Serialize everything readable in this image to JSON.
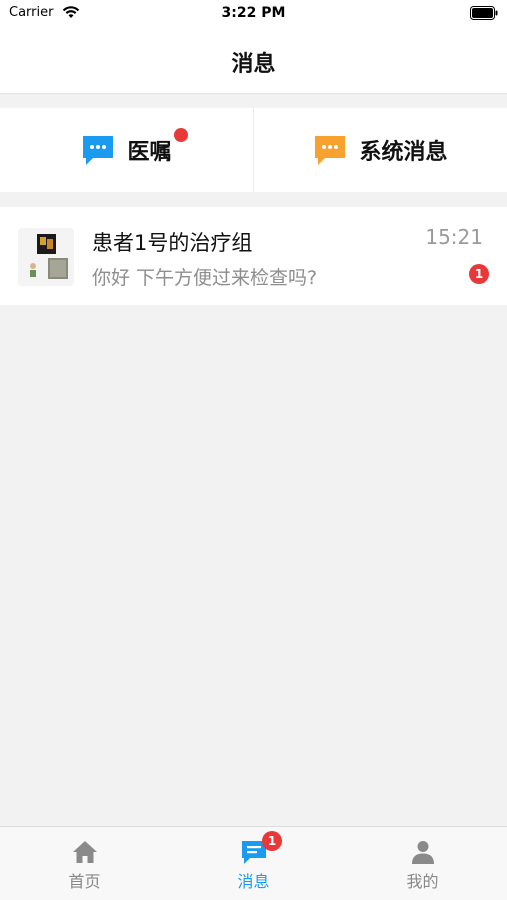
{
  "status_bar": {
    "carrier": "Carrier",
    "time": "3:22 PM"
  },
  "nav": {
    "title": "消息"
  },
  "categories": [
    {
      "label": "医嘱",
      "icon": "chat-bubble-icon",
      "color": "#1a9bf0",
      "has_dot": true
    },
    {
      "label": "系统消息",
      "icon": "chat-bubble-icon",
      "color": "#f7a12f",
      "has_dot": false
    }
  ],
  "conversations": [
    {
      "name": "患者1号的治疗组",
      "preview": "你好 下午方便过来检查吗?",
      "time": "15:21",
      "unread": "1",
      "avatar_icon": "group-avatar"
    }
  ],
  "tabs": [
    {
      "label": "首页",
      "icon": "home-icon",
      "active": false
    },
    {
      "label": "消息",
      "icon": "message-icon",
      "active": true,
      "badge": "1"
    },
    {
      "label": "我的",
      "icon": "person-icon",
      "active": false
    }
  ],
  "colors": {
    "accent": "#1a9bf0",
    "orange": "#f7a12f",
    "badge_red": "#e8393a",
    "background": "#f2f2f2"
  }
}
